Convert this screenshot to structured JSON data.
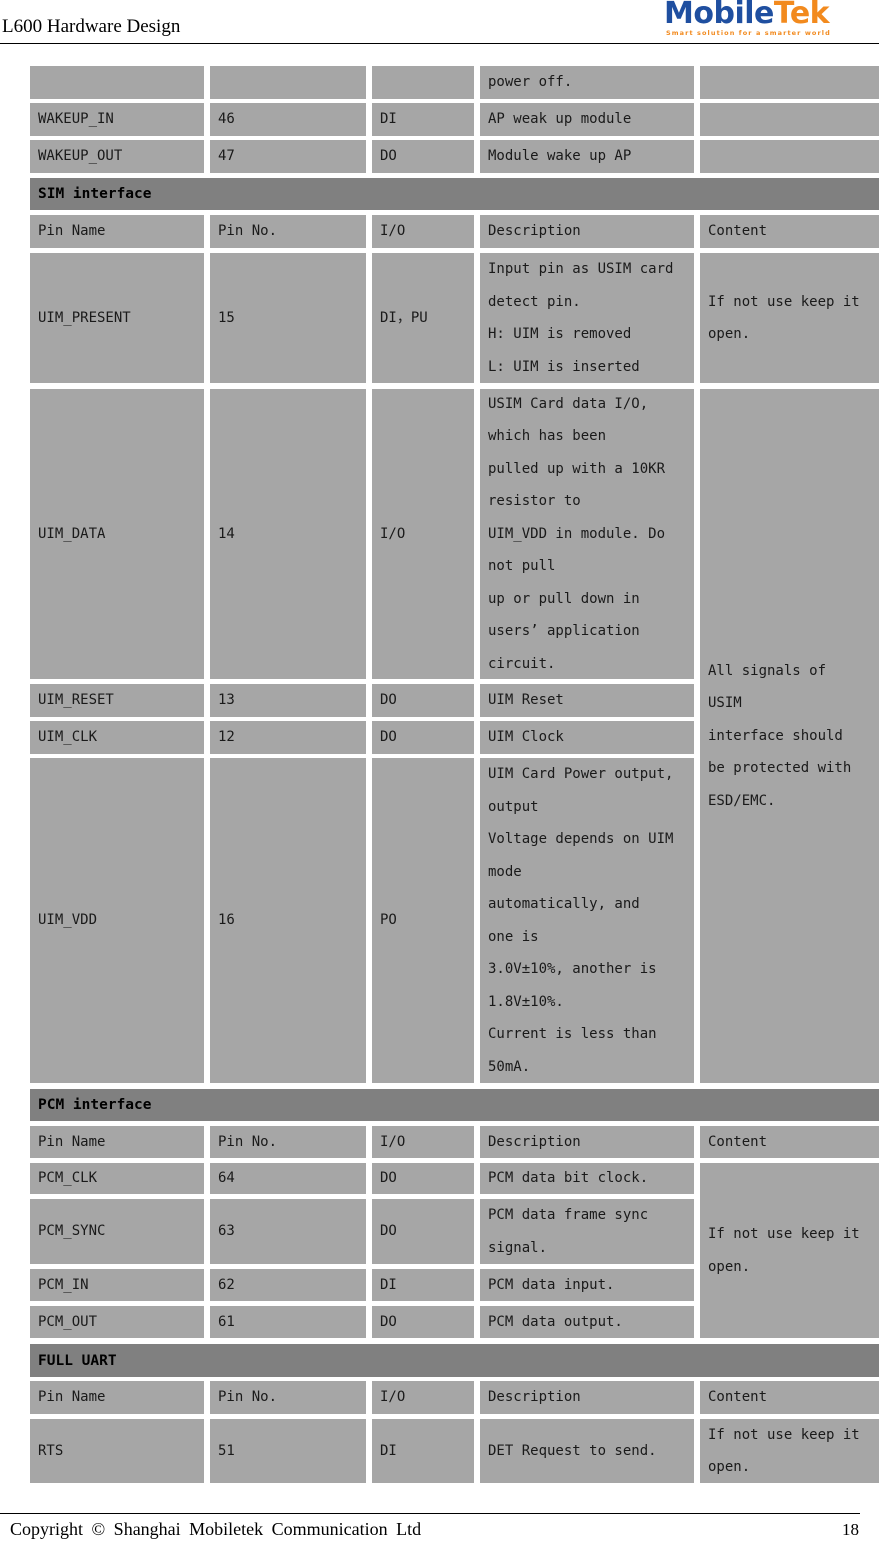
{
  "header": {
    "doc_title": "L600 Hardware Design",
    "logo": {
      "mark": "M",
      "word_a": "obile",
      "word_b": "Tek",
      "tagline": "Smart solution for a smarter world"
    }
  },
  "colors": {
    "cell": "#a6a6a6",
    "section": "#808080",
    "logo_blue": "#1f4fa0",
    "logo_orange": "#f28a1e"
  },
  "columns": [
    "Pin Name",
    "Pin No.",
    "I/O",
    "Description",
    "Content"
  ],
  "continued_rows": [
    {
      "name": "",
      "no": "",
      "io": "",
      "desc": "power off.",
      "content": ""
    },
    {
      "name": "WAKEUP_IN",
      "no": "46",
      "io": "DI",
      "desc": "AP weak up module",
      "content": ""
    },
    {
      "name": "WAKEUP_OUT",
      "no": "47",
      "io": "DO",
      "desc": "Module wake up AP",
      "content": ""
    }
  ],
  "sim": {
    "title": "SIM interface",
    "rows": [
      {
        "name": "UIM_PRESENT",
        "no": "15",
        "io": "DI，PU",
        "desc": "Input pin as USIM card\ndetect pin.\nH: UIM is removed\nL: UIM is inserted",
        "content": "If not use keep it\nopen."
      },
      {
        "name": "UIM_DATA",
        "no": "14",
        "io": "I/O",
        "desc": "USIM Card data I/O,\nwhich has been\npulled up with a 10KR\nresistor to\nUIM_VDD in module. Do\nnot pull\nup or pull down in\nusers’ application\ncircuit."
      },
      {
        "name": "UIM_RESET",
        "no": "13",
        "io": "DO",
        "desc": "UIM Reset"
      },
      {
        "name": "UIM_CLK",
        "no": "12",
        "io": "DO",
        "desc": "UIM Clock"
      },
      {
        "name": "UIM_VDD",
        "no": "16",
        "io": "PO",
        "desc": "UIM Card Power output,\noutput\nVoltage depends on UIM\nmode\nautomatically,  and\none is\n3.0V±10%, another is\n1.8V±10%.\nCurrent is less than\n50mA."
      }
    ],
    "shared_content": "All signals of\nUSIM\ninterface should\nbe protected with\nESD/EMC."
  },
  "pcm": {
    "title": "PCM interface",
    "rows": [
      {
        "name": "PCM_CLK",
        "no": "64",
        "io": "DO",
        "desc": "PCM data bit clock."
      },
      {
        "name": "PCM_SYNC",
        "no": "63",
        "io": "DO",
        "desc": "PCM data frame sync\nsignal."
      },
      {
        "name": "PCM_IN",
        "no": "62",
        "io": "DI",
        "desc": "PCM data input."
      },
      {
        "name": "PCM_OUT",
        "no": "61",
        "io": "DO",
        "desc": "PCM data output."
      }
    ],
    "shared_content": "If not use keep it\nopen."
  },
  "uart": {
    "title": "FULL UART",
    "rows": [
      {
        "name": "RTS",
        "no": "51",
        "io": "DI",
        "desc": "DET Request to send.",
        "content": "If not use keep it\nopen."
      }
    ]
  },
  "footer": {
    "copyright": "Copyright © Shanghai Mobiletek Communication Ltd",
    "page": "18"
  }
}
